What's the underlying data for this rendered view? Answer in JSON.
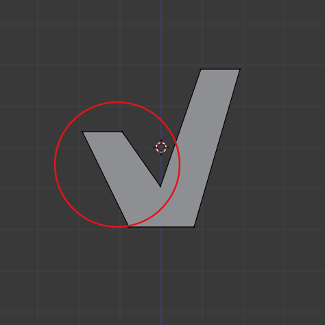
{
  "viewport": {
    "view": "top-orthographic",
    "grid_visible": true,
    "colors": {
      "background": "#393939",
      "grid_line": "#444444",
      "x_axis": "#7a2a2a",
      "y_axis": "#3b3bb0",
      "mesh_face": "#8e8f93",
      "mesh_edge": "#000000",
      "brush_circle": "#e0161b",
      "cursor": "#e0161b"
    },
    "mesh": {
      "object": "checkmark-shape",
      "vertex_count": 6
    },
    "tool": {
      "type": "circle-select-brush"
    },
    "cursor_icon": "3d-cursor-icon"
  }
}
